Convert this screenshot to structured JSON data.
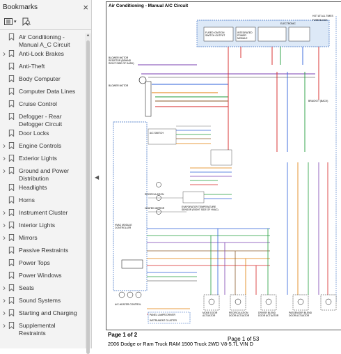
{
  "sidebar": {
    "title": "Bookmarks",
    "close_symbol": "×",
    "bookmarks": [
      {
        "label": "Air Conditioning - Manual A_C Circuit",
        "expandable": false
      },
      {
        "label": "Anti-Lock Brakes",
        "expandable": true
      },
      {
        "label": "Anti-Theft",
        "expandable": false
      },
      {
        "label": "Body Computer",
        "expandable": false
      },
      {
        "label": "Computer Data Lines",
        "expandable": false
      },
      {
        "label": "Cruise Control",
        "expandable": false
      },
      {
        "label": "Defogger - Rear Defogger Circuit",
        "expandable": false
      },
      {
        "label": "Door Locks",
        "expandable": false
      },
      {
        "label": "Engine Controls",
        "expandable": true
      },
      {
        "label": "Exterior Lights",
        "expandable": true
      },
      {
        "label": "Ground and Power Distribution",
        "expandable": true
      },
      {
        "label": "Headlights",
        "expandable": false
      },
      {
        "label": "Horns",
        "expandable": false
      },
      {
        "label": "Instrument Cluster",
        "expandable": true
      },
      {
        "label": "Interior Lights",
        "expandable": true
      },
      {
        "label": "Mirrors",
        "expandable": true
      },
      {
        "label": "Passive Restraints",
        "expandable": false
      },
      {
        "label": "Power Tops",
        "expandable": false
      },
      {
        "label": "Power Windows",
        "expandable": false
      },
      {
        "label": "Seats",
        "expandable": true
      },
      {
        "label": "Sound Systems",
        "expandable": true
      },
      {
        "label": "Starting and Charging",
        "expandable": true
      },
      {
        "label": "Supplemental Restraints",
        "expandable": true
      }
    ]
  },
  "document": {
    "diagram_title": "Air Conditioning - Manual A/C Circuit",
    "page_label": "Page 1 of 2",
    "page_counter": "Page 1 of 53",
    "footer_title": "2006 Dodge or Ram Truck RAM 1500 Truck 2WD V8-5.7L VIN D",
    "labels": {
      "hot_at_all_times": "HOT AT ALL TIMES",
      "fuse_block": "FUSE BLOCK",
      "integrated_power_module": "INTEGRATED POWER MODULE",
      "electronic": "ELECTRONIC",
      "fused_ignition": "FUSED IGNITION SWITCH OUTPUT",
      "blower_motor": "BLOWER MOTOR",
      "blower_resistor": "BLOWER MOTOR RESISTOR (BEHIND RIGHT SIDE OF DASH)",
      "ac_switch": "A/C SWITCH",
      "recirculation": "RECIRCULATION",
      "heated_mirror": "HEATED MIRROR",
      "hvac_control": "HVAC MODULE CONTROLLER",
      "evaporator_sensor": "EVAPORATOR TEMPERATURE SENSOR (RIGHT SIDE OF HVAC)",
      "mode_door": "MODE DOOR ACTUATOR",
      "recirc_door": "RECIRCULATION DOOR ACTUATOR",
      "driver_blend": "DRIVER BLEND DOOR ACTUATOR",
      "passenger_blend": "PASSENGER BLEND DOOR ACTUATOR",
      "instrument_cluster": "INSTRUMENT CLUSTER",
      "ac_heater_control": "A/C-HEATER CONTROL",
      "panel_lamps": "PANEL LAMPS DRIVER",
      "bracket": "BRACKET (BACK)"
    }
  },
  "colors": {
    "wire_violet": "#7a3fb0",
    "wire_blue": "#2b5fd9",
    "wire_orange": "#e07b00",
    "wire_green": "#1f9b3a",
    "wire_red": "#d62020",
    "wire_brown": "#8a5a2a",
    "wire_gray": "#777777"
  },
  "icons": {
    "bookmark": "bookmark-outline-icon",
    "options": "list-options-icon",
    "search_bookmark": "bookmark-search-icon"
  }
}
